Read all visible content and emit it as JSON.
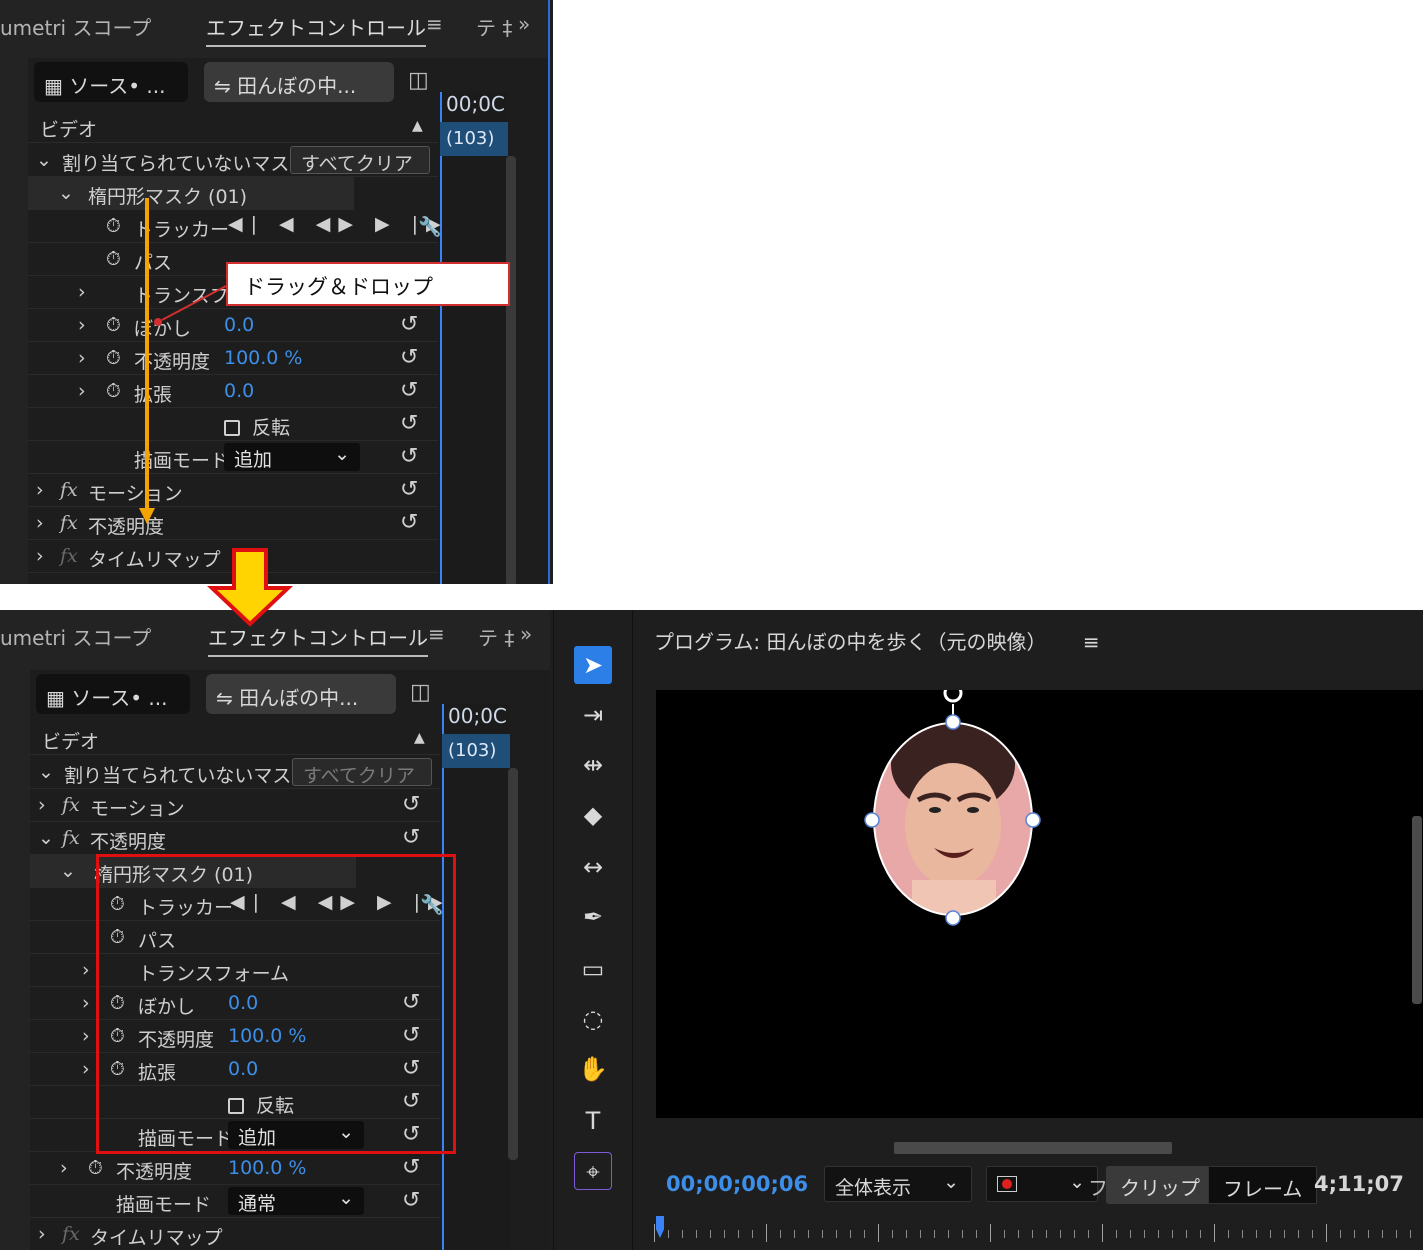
{
  "top_panel": {
    "tabs": {
      "lumetri": "umetri スコープ",
      "effect_controls": "エフェクトコントロール",
      "menu_glyph": "≡",
      "text": "テ ‡",
      "more": "»"
    },
    "source_tab": "ソース• ...",
    "clip_tab": "田んぼの中...",
    "timecode_head": "00;0C",
    "frame_badge": "(103)",
    "section_video": "ビデオ",
    "unassigned_mask": "割り当てられていないマスク",
    "clear_all": "すべてクリア",
    "ellipse_mask": "楕円形マスク (01)",
    "tracker": "トラッカー",
    "path": "パス",
    "transform": "トランスフ",
    "feather": "ぼかし",
    "feather_value": "0.0",
    "opacity": "不透明度",
    "opacity_value": "100.0 %",
    "expansion": "拡張",
    "expansion_value": "0.0",
    "invert": "反転",
    "blend_mode_label": "描画モード",
    "blend_mode_value": "追加",
    "motion": "モーション",
    "opacity_fx": "不透明度",
    "time_remap": "タイムリマップ",
    "callout": "ドラッグ＆ドロップ"
  },
  "bottom_panel": {
    "tabs": {
      "lumetri": "umetri スコープ",
      "effect_controls": "エフェクトコントロール",
      "menu_glyph": "≡",
      "text": "テ ‡",
      "more": "»"
    },
    "source_tab": "ソース• ...",
    "clip_tab": "田んぼの中...",
    "timecode_head": "00;0C",
    "frame_badge": "(103)",
    "section_video": "ビデオ",
    "unassigned_mask": "割り当てられていないマスク",
    "clear_all": "すべてクリア",
    "motion": "モーション",
    "opacity_fx": "不透明度",
    "ellipse_mask": "楕円形マスク (01)",
    "tracker": "トラッカー",
    "path": "パス",
    "transform": "トランスフォーム",
    "feather": "ぼかし",
    "feather_value": "0.0",
    "mask_opacity": "不透明度",
    "mask_opacity_value": "100.0 %",
    "expansion": "拡張",
    "expansion_value": "0.0",
    "invert": "反転",
    "blend_mode_label": "描画モード",
    "blend_mode_value": "追加",
    "opacity": "不透明度",
    "opacity_value": "100.0 %",
    "blend_mode2_label": "描画モード",
    "blend_mode2_value": "通常",
    "time_remap": "タイムリマップ"
  },
  "program": {
    "title": "プログラム: 田んぼの中を歩く（元の映像）",
    "menu_glyph": "≡",
    "timecode": "00;00;00;06",
    "zoom": "全体表示",
    "clip_label": "クリップ",
    "frame_label": "フレーム",
    "end_timecode": "4;11;07",
    "fa_fragment": "フ"
  },
  "icons": {
    "tracker_controls": "◀| ◀ ◀▶ ▶ |▶",
    "reset": "↺"
  },
  "colors": {
    "accent": "#3d8ee8",
    "annotation_red": "#e01010",
    "arrow_yellow": "#ffcc00",
    "arrow_orange": "#f5a300"
  }
}
